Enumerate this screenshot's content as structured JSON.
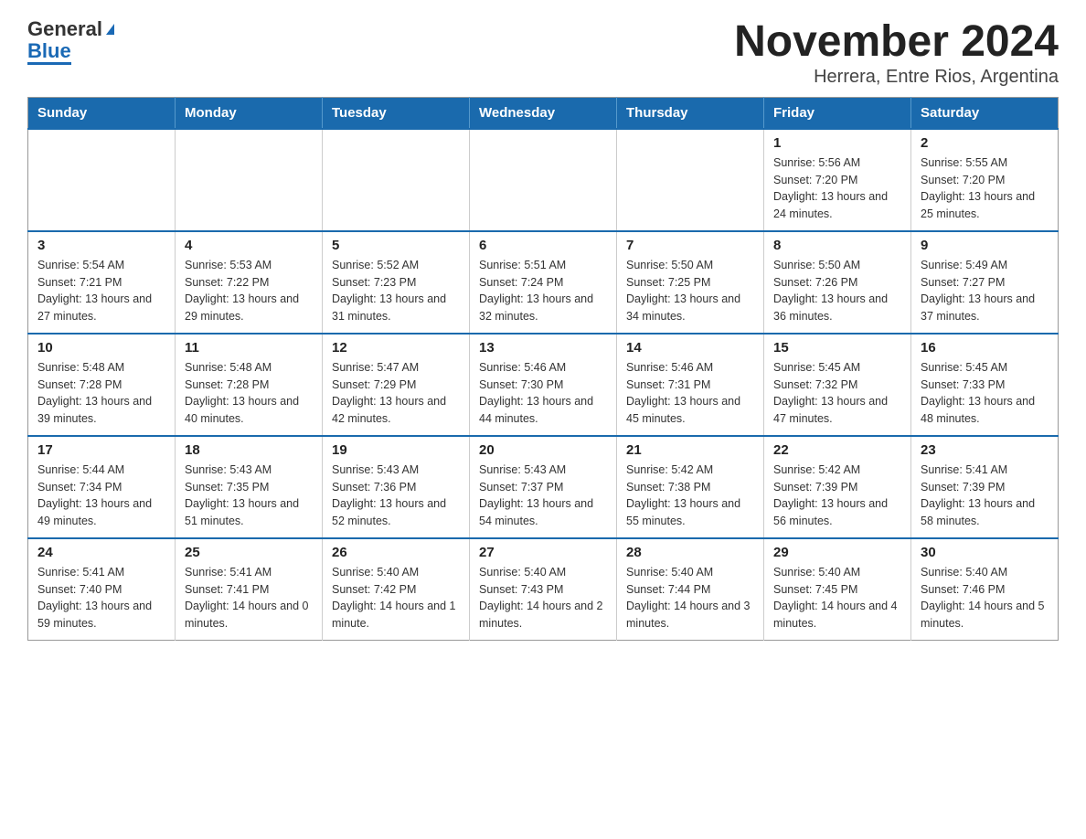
{
  "logo": {
    "line1": "General",
    "triangle": "▶",
    "line2": "Blue"
  },
  "title": "November 2024",
  "subtitle": "Herrera, Entre Rios, Argentina",
  "days_of_week": [
    "Sunday",
    "Monday",
    "Tuesday",
    "Wednesday",
    "Thursday",
    "Friday",
    "Saturday"
  ],
  "weeks": [
    [
      {
        "day": "",
        "info": ""
      },
      {
        "day": "",
        "info": ""
      },
      {
        "day": "",
        "info": ""
      },
      {
        "day": "",
        "info": ""
      },
      {
        "day": "",
        "info": ""
      },
      {
        "day": "1",
        "info": "Sunrise: 5:56 AM\nSunset: 7:20 PM\nDaylight: 13 hours and 24 minutes."
      },
      {
        "day": "2",
        "info": "Sunrise: 5:55 AM\nSunset: 7:20 PM\nDaylight: 13 hours and 25 minutes."
      }
    ],
    [
      {
        "day": "3",
        "info": "Sunrise: 5:54 AM\nSunset: 7:21 PM\nDaylight: 13 hours and 27 minutes."
      },
      {
        "day": "4",
        "info": "Sunrise: 5:53 AM\nSunset: 7:22 PM\nDaylight: 13 hours and 29 minutes."
      },
      {
        "day": "5",
        "info": "Sunrise: 5:52 AM\nSunset: 7:23 PM\nDaylight: 13 hours and 31 minutes."
      },
      {
        "day": "6",
        "info": "Sunrise: 5:51 AM\nSunset: 7:24 PM\nDaylight: 13 hours and 32 minutes."
      },
      {
        "day": "7",
        "info": "Sunrise: 5:50 AM\nSunset: 7:25 PM\nDaylight: 13 hours and 34 minutes."
      },
      {
        "day": "8",
        "info": "Sunrise: 5:50 AM\nSunset: 7:26 PM\nDaylight: 13 hours and 36 minutes."
      },
      {
        "day": "9",
        "info": "Sunrise: 5:49 AM\nSunset: 7:27 PM\nDaylight: 13 hours and 37 minutes."
      }
    ],
    [
      {
        "day": "10",
        "info": "Sunrise: 5:48 AM\nSunset: 7:28 PM\nDaylight: 13 hours and 39 minutes."
      },
      {
        "day": "11",
        "info": "Sunrise: 5:48 AM\nSunset: 7:28 PM\nDaylight: 13 hours and 40 minutes."
      },
      {
        "day": "12",
        "info": "Sunrise: 5:47 AM\nSunset: 7:29 PM\nDaylight: 13 hours and 42 minutes."
      },
      {
        "day": "13",
        "info": "Sunrise: 5:46 AM\nSunset: 7:30 PM\nDaylight: 13 hours and 44 minutes."
      },
      {
        "day": "14",
        "info": "Sunrise: 5:46 AM\nSunset: 7:31 PM\nDaylight: 13 hours and 45 minutes."
      },
      {
        "day": "15",
        "info": "Sunrise: 5:45 AM\nSunset: 7:32 PM\nDaylight: 13 hours and 47 minutes."
      },
      {
        "day": "16",
        "info": "Sunrise: 5:45 AM\nSunset: 7:33 PM\nDaylight: 13 hours and 48 minutes."
      }
    ],
    [
      {
        "day": "17",
        "info": "Sunrise: 5:44 AM\nSunset: 7:34 PM\nDaylight: 13 hours and 49 minutes."
      },
      {
        "day": "18",
        "info": "Sunrise: 5:43 AM\nSunset: 7:35 PM\nDaylight: 13 hours and 51 minutes."
      },
      {
        "day": "19",
        "info": "Sunrise: 5:43 AM\nSunset: 7:36 PM\nDaylight: 13 hours and 52 minutes."
      },
      {
        "day": "20",
        "info": "Sunrise: 5:43 AM\nSunset: 7:37 PM\nDaylight: 13 hours and 54 minutes."
      },
      {
        "day": "21",
        "info": "Sunrise: 5:42 AM\nSunset: 7:38 PM\nDaylight: 13 hours and 55 minutes."
      },
      {
        "day": "22",
        "info": "Sunrise: 5:42 AM\nSunset: 7:39 PM\nDaylight: 13 hours and 56 minutes."
      },
      {
        "day": "23",
        "info": "Sunrise: 5:41 AM\nSunset: 7:39 PM\nDaylight: 13 hours and 58 minutes."
      }
    ],
    [
      {
        "day": "24",
        "info": "Sunrise: 5:41 AM\nSunset: 7:40 PM\nDaylight: 13 hours and 59 minutes."
      },
      {
        "day": "25",
        "info": "Sunrise: 5:41 AM\nSunset: 7:41 PM\nDaylight: 14 hours and 0 minutes."
      },
      {
        "day": "26",
        "info": "Sunrise: 5:40 AM\nSunset: 7:42 PM\nDaylight: 14 hours and 1 minute."
      },
      {
        "day": "27",
        "info": "Sunrise: 5:40 AM\nSunset: 7:43 PM\nDaylight: 14 hours and 2 minutes."
      },
      {
        "day": "28",
        "info": "Sunrise: 5:40 AM\nSunset: 7:44 PM\nDaylight: 14 hours and 3 minutes."
      },
      {
        "day": "29",
        "info": "Sunrise: 5:40 AM\nSunset: 7:45 PM\nDaylight: 14 hours and 4 minutes."
      },
      {
        "day": "30",
        "info": "Sunrise: 5:40 AM\nSunset: 7:46 PM\nDaylight: 14 hours and 5 minutes."
      }
    ]
  ]
}
